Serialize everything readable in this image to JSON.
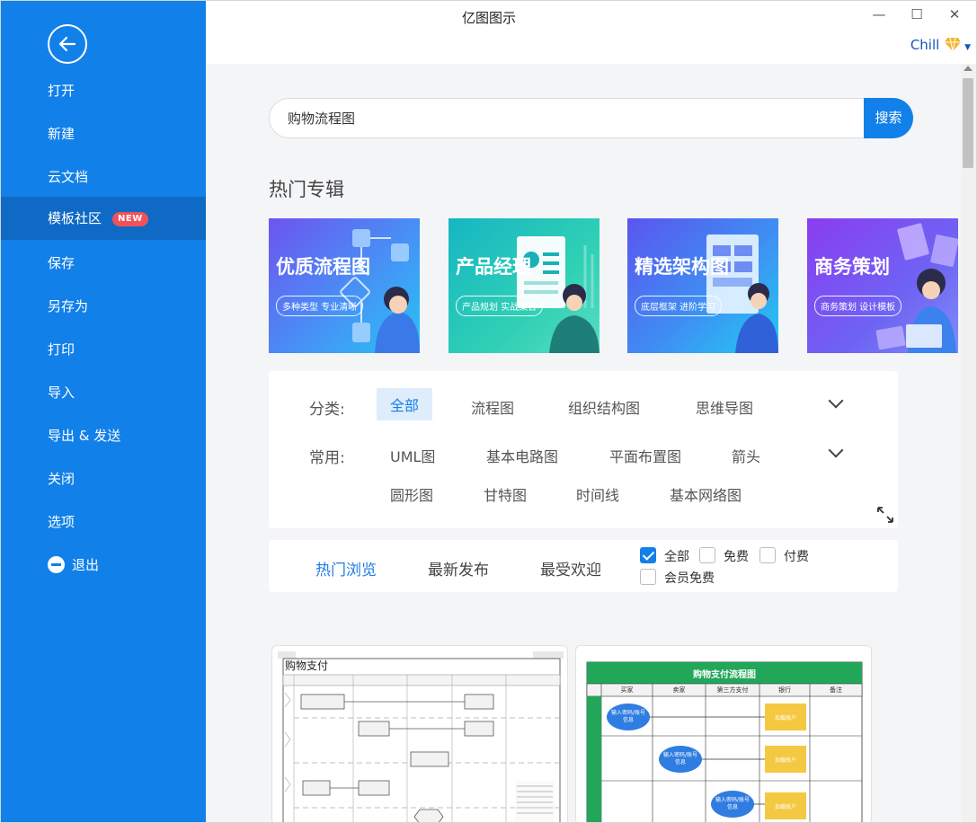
{
  "window": {
    "title": "亿图图示",
    "minimize": "—",
    "maximize": "☐",
    "close": "✕"
  },
  "user": {
    "name": "Chill"
  },
  "sidebar": {
    "items": [
      {
        "label": "打开"
      },
      {
        "label": "新建"
      },
      {
        "label": "云文档"
      },
      {
        "label": "模板社区",
        "badge": "NEW"
      },
      {
        "label": "保存"
      },
      {
        "label": "另存为"
      },
      {
        "label": "打印"
      },
      {
        "label": "导入"
      },
      {
        "label": "导出 & 发送"
      },
      {
        "label": "关闭"
      },
      {
        "label": "选项"
      }
    ],
    "exit_label": "退出"
  },
  "search": {
    "value": "购物流程图",
    "button_label": "搜索"
  },
  "hot": {
    "title": "热门专辑",
    "banners": [
      {
        "title": "优质流程图",
        "subtitle": "多种类型 专业清晰"
      },
      {
        "title": "产品经理",
        "subtitle": "产品规划 实战集合"
      },
      {
        "title": "精选架构图",
        "subtitle": "底层框架 进阶学习"
      },
      {
        "title": "商务策划",
        "subtitle": "商务策划 设计模板"
      }
    ]
  },
  "filter": {
    "category_label": "分类:",
    "categories": [
      "全部",
      "流程图",
      "组织结构图",
      "思维导图"
    ],
    "common_label": "常用:",
    "common_row1": [
      "UML图",
      "基本电路图",
      "平面布置图",
      "箭头"
    ],
    "common_row2": [
      "圆形图",
      "甘特图",
      "时间线",
      "基本网络图"
    ]
  },
  "sort": {
    "tabs": [
      "热门浏览",
      "最新发布",
      "最受欢迎"
    ],
    "checks": [
      {
        "label": "全部",
        "checked": true
      },
      {
        "label": "免费",
        "checked": false
      },
      {
        "label": "付费",
        "checked": false
      },
      {
        "label": "会员免费",
        "checked": false
      }
    ]
  },
  "cards": [
    {
      "title": "购物支付"
    },
    {
      "title": "购物支付流程图",
      "columns": [
        "买家",
        "卖家",
        "第三方支付",
        "银行",
        "备注"
      ],
      "node": "输入密码/账号信息",
      "box": "加载账户"
    }
  ],
  "colors": {
    "sidebar": "#1280e9",
    "sidebar_active": "#0f6ac6",
    "accent": "#1280e9",
    "badge": "#f0525a",
    "card_green": "#22a65a",
    "card_yellow": "#f5c842"
  }
}
